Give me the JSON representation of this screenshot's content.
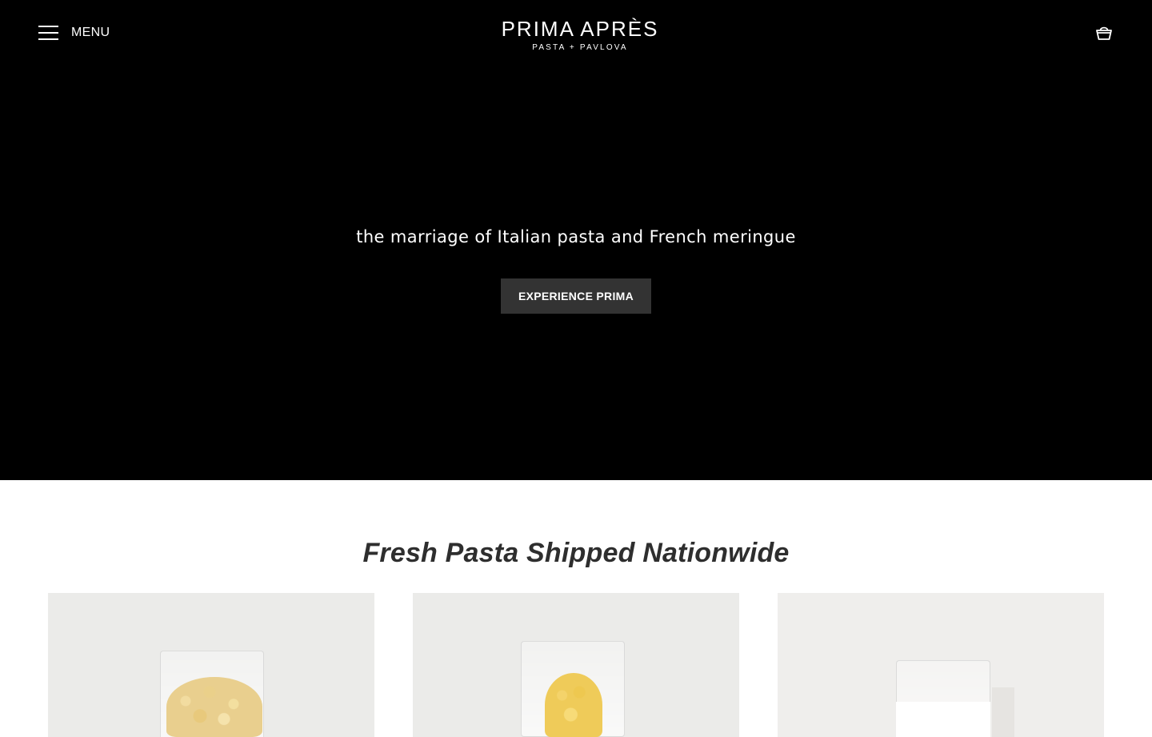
{
  "header": {
    "menu_label": "MENU",
    "logo_title": "PRIMA APRÈS",
    "logo_subtitle": "PASTA + PAVLOVA",
    "icons": {
      "menu": "hamburger-icon",
      "cart": "cart-icon"
    }
  },
  "hero": {
    "tagline": "the marriage of Italian pasta and French meringue",
    "cta_label": "EXPERIENCE PRIMA",
    "background_color": "#000000",
    "button_color": "#333333"
  },
  "products_section": {
    "title": "Fresh Pasta Shipped Nationwide",
    "title_color": "#2e2e2e"
  }
}
